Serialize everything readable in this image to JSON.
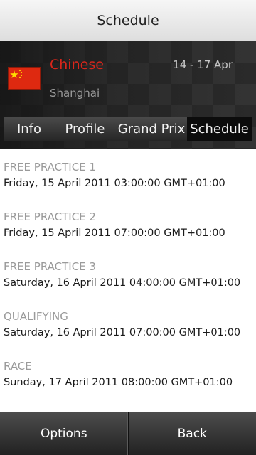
{
  "titlebar": {
    "title": "Schedule"
  },
  "race": {
    "name": "Chinese",
    "dates": "14 - 17 Apr",
    "city": "Shanghai",
    "flag_icon": "china-flag-icon",
    "name_color": "#d8261b"
  },
  "tabs": [
    {
      "label": "Info"
    },
    {
      "label": "Profile"
    },
    {
      "label": "Grand Prix"
    },
    {
      "label": "Schedule",
      "selected": true
    }
  ],
  "sessions": [
    {
      "label": "FREE PRACTICE 1",
      "time": "Friday, 15 April 2011 03:00:00 GMT+01:00"
    },
    {
      "label": "FREE PRACTICE 2",
      "time": "Friday, 15 April 2011 07:00:00 GMT+01:00"
    },
    {
      "label": "FREE PRACTICE 3",
      "time": "Saturday, 16 April 2011 04:00:00 GMT+01:00"
    },
    {
      "label": "QUALIFYING",
      "time": "Saturday, 16 April 2011 07:00:00 GMT+01:00"
    },
    {
      "label": "RACE",
      "time": "Sunday, 17 April 2011 08:00:00 GMT+01:00"
    }
  ],
  "softkeys": {
    "left": "Options",
    "right": "Back"
  }
}
